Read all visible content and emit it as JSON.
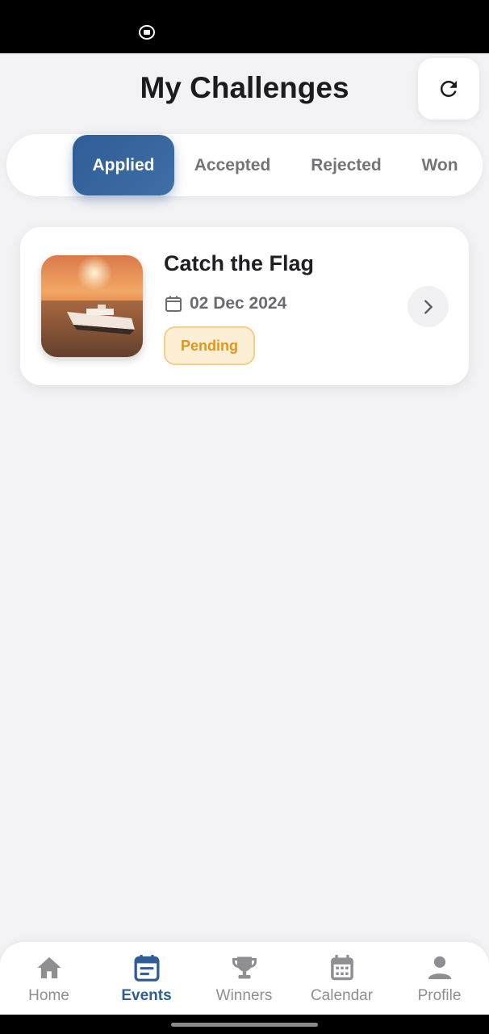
{
  "header": {
    "title": "My Challenges",
    "refresh_icon": "refresh-icon"
  },
  "tabs": [
    {
      "label": "Applied",
      "active": true
    },
    {
      "label": "Accepted",
      "active": false
    },
    {
      "label": "Rejected",
      "active": false
    },
    {
      "label": "Won",
      "active": false
    }
  ],
  "challenges": [
    {
      "title": "Catch the Flag",
      "date": "02 Dec 2024",
      "status": "Pending",
      "image": "cruise-ship-sunset"
    }
  ],
  "bottom_nav": [
    {
      "label": "Home",
      "icon": "home-icon",
      "active": false
    },
    {
      "label": "Events",
      "icon": "events-icon",
      "active": true
    },
    {
      "label": "Winners",
      "icon": "trophy-icon",
      "active": false
    },
    {
      "label": "Calendar",
      "icon": "calendar-icon",
      "active": false
    },
    {
      "label": "Profile",
      "icon": "person-icon",
      "active": false
    }
  ],
  "colors": {
    "accent": "#2f5d97",
    "pending_text": "#e0961a",
    "pending_bg": "#fdefd6",
    "background": "#f3f3f5"
  }
}
